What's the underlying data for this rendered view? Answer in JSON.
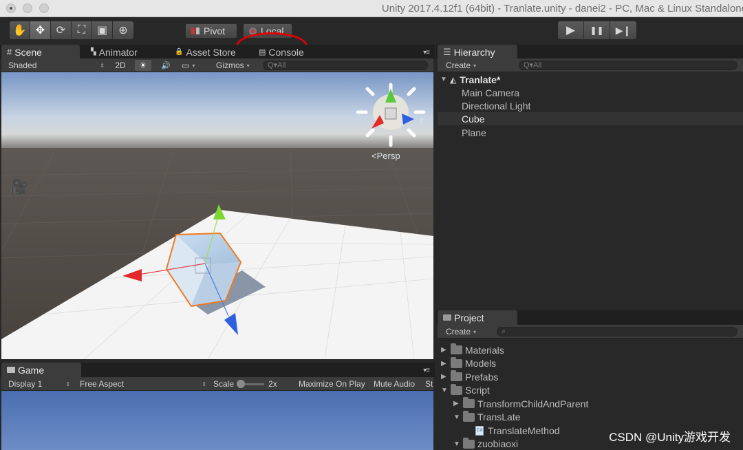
{
  "window": {
    "title": "Unity 2017.4.12f1 (64bit) - Tranlate.unity - danei2 - PC, Mac & Linux Standalone"
  },
  "toolbar": {
    "tools": [
      {
        "name": "hand-tool-icon",
        "glyph": "✋"
      },
      {
        "name": "move-tool-icon",
        "glyph": "✥"
      },
      {
        "name": "rotate-tool-icon",
        "glyph": "⟳"
      },
      {
        "name": "scale-tool-icon",
        "glyph": "⛶"
      },
      {
        "name": "rect-tool-icon",
        "glyph": "▣"
      },
      {
        "name": "transform-tool-icon",
        "glyph": "⊕"
      }
    ],
    "pivot_label": "Pivot",
    "local_label": "Local",
    "play_glyph": "▶",
    "pause_glyph": "❚❚",
    "step_glyph": "▶❙",
    "highlight_color": "#e00000"
  },
  "scene_panel": {
    "tabs": [
      {
        "label": "Scene",
        "glyph": "#"
      },
      {
        "label": "Animator",
        "glyph": "▚"
      },
      {
        "label": "Asset Store",
        "glyph": "🔒"
      },
      {
        "label": "Console",
        "glyph": "▤"
      }
    ],
    "shading_mode": "Shaded",
    "toggle_2d": "2D",
    "lighting_glyph": "☀",
    "audio_glyph": "🔊",
    "effects_glyph": "▭",
    "gizmos_label": "Gizmos",
    "search_placeholder": "Q▾All",
    "projection_label": "Persp",
    "camera_glyph": "🎥"
  },
  "game_panel": {
    "tab_label": "Game",
    "display": "Display 1",
    "aspect": "Free Aspect",
    "scale_label": "Scale",
    "scale_value": "2x",
    "maximize_label": "Maximize On Play",
    "mute_label": "Mute Audio",
    "stats_label": "St"
  },
  "hierarchy": {
    "tab_label": "Hierarchy",
    "create_label": "Create",
    "search_placeholder": "Q▾All",
    "scene_name": "Tranlate*",
    "items": [
      "Main Camera",
      "Directional Light",
      "Cube",
      "Plane"
    ],
    "selected": "Cube"
  },
  "project": {
    "tab_label": "Project",
    "create_label": "Create",
    "items": [
      {
        "label": "Materials",
        "depth": 0,
        "arrow": "▶",
        "kind": "folder"
      },
      {
        "label": "Models",
        "depth": 0,
        "arrow": "▶",
        "kind": "folder"
      },
      {
        "label": "Prefabs",
        "depth": 0,
        "arrow": "▶",
        "kind": "folder"
      },
      {
        "label": "Script",
        "depth": 0,
        "arrow": "▼",
        "kind": "folder"
      },
      {
        "label": "TransformChildAndParent",
        "depth": 1,
        "arrow": "▶",
        "kind": "folder"
      },
      {
        "label": "TransLate",
        "depth": 1,
        "arrow": "▼",
        "kind": "folder"
      },
      {
        "label": "TranslateMethod",
        "depth": 2,
        "arrow": "",
        "kind": "script"
      },
      {
        "label": "zuobiaoxi",
        "depth": 1,
        "arrow": "▼",
        "kind": "folder"
      }
    ]
  },
  "watermark": "CSDN @Unity游戏开发"
}
